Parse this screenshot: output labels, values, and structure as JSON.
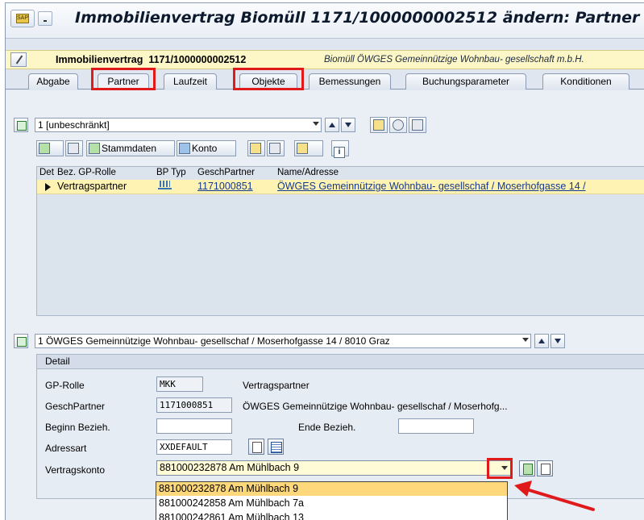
{
  "window": {
    "title": "Immobilienvertrag Biomüll 1171/1000000002512 ändern: Partner"
  },
  "header": {
    "contract_label": "Immobilienvertrag",
    "contract_number": "1171/1000000002512",
    "description": "Biomüll ÖWGES Gemeinnützige Wohnbau- gesellschaft m.b.H."
  },
  "tabs": [
    {
      "label": "Abgabe"
    },
    {
      "label": "Partner",
      "active": true
    },
    {
      "label": "Laufzeit"
    },
    {
      "label": "Objekte"
    },
    {
      "label": "Bemessungen"
    },
    {
      "label": "Buchungsparameter"
    },
    {
      "label": "Konditionen"
    }
  ],
  "partner_list": {
    "selector_value": "1 [unbeschränkt]",
    "toolbar": {
      "stammdaten_label": "Stammdaten",
      "konto_label": "Konto"
    },
    "columns": [
      "Det",
      "Bez. GP-Rolle",
      "BP Typ",
      "GeschPartner",
      "Name/Adresse"
    ],
    "rows": [
      {
        "role": "Vertragspartner",
        "bp_type_icon": "organization-icon",
        "partner": "1171000851",
        "name_address": "ÖWGES Gemeinnützige Wohnbau- gesellschaf / Moserhofgasse 14 /"
      }
    ]
  },
  "detail": {
    "selector_value": "1 ÖWGES Gemeinnützige Wohnbau- gesellschaf / Moserhofgasse 14 / 8010 Graz",
    "group_title": "Detail",
    "gp_rolle_label": "GP-Rolle",
    "gp_rolle_value": "MKK",
    "gp_rolle_text": "Vertragspartner",
    "partner_label": "GeschPartner",
    "partner_value": "1171000851",
    "partner_text": "ÖWGES Gemeinnützige Wohnbau- gesellschaf / Moserhofg...",
    "beginn_label": "Beginn Bezieh.",
    "beginn_value": "",
    "ende_label": "Ende Bezieh.",
    "ende_value": "",
    "adressart_label": "Adressart",
    "adressart_value": "XXDEFAULT",
    "vertragskonto_label": "Vertragskonto",
    "vertragskonto_value": "881000232878 Am Mühlbach 9",
    "vertragskonto_options": [
      "881000232878 Am Mühlbach 9",
      "881000242858 Am Mühlbach 7a",
      "881000242861 Am Mühlbach 13"
    ]
  },
  "colors": {
    "highlight": "#e01a1a",
    "selected_row": "#fff3b3",
    "selected_option": "#ffd87b"
  }
}
